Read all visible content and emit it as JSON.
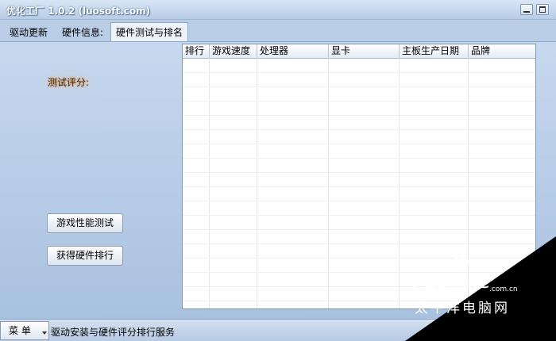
{
  "window": {
    "title": "优化工厂 1.0.2 (luosoft.com)"
  },
  "tabs": [
    {
      "label": "驱动更新"
    },
    {
      "label": "硬件信息:"
    },
    {
      "label": "硬件测试与排名"
    }
  ],
  "panel": {
    "score_label": "测试评分:",
    "buttons": {
      "perf_test": "游戏性能测试",
      "get_ranking": "获得硬件排行"
    }
  },
  "table": {
    "columns": [
      "排行",
      "游戏速度",
      "处理器",
      "显卡",
      "主板生产日期",
      "品牌"
    ]
  },
  "statusbar": {
    "menu_label": "菜 单",
    "status_text": "驱动安装与硬件评分排行服务"
  },
  "watermark": {
    "logo_p": "P",
    "logo_rest": "Conline",
    "domain": ".com.cn",
    "subtitle": "太平洋电脑网"
  },
  "colors": {
    "background": "#b9cde6",
    "grid_background": "#ffffff",
    "score_glow": "#ff9a3c"
  }
}
